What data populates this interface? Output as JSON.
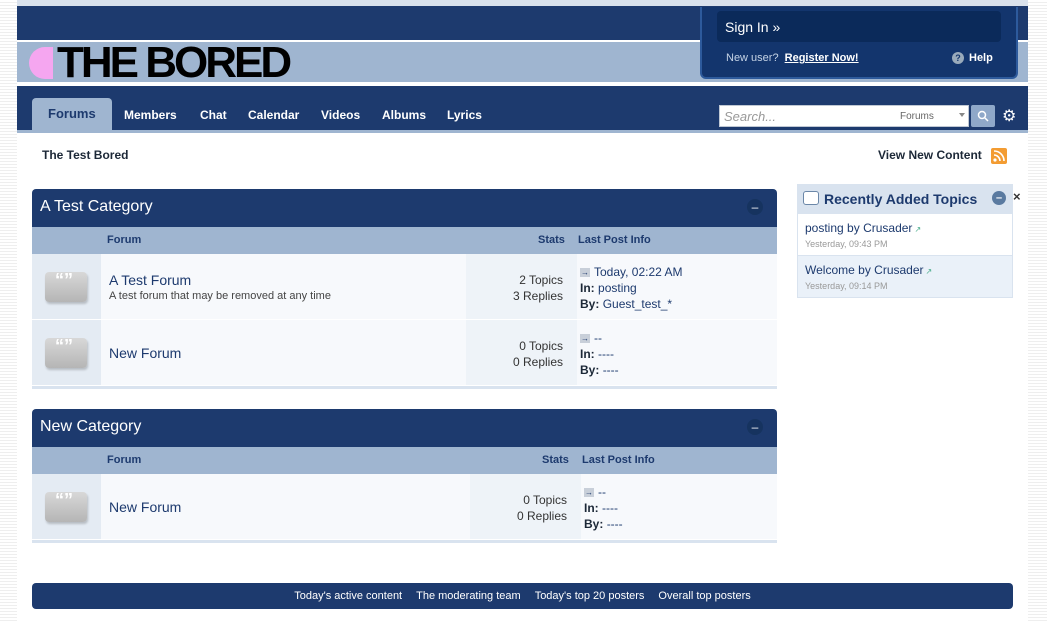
{
  "header": {
    "logo_text": "THE BORED",
    "signin_label": "Sign In »",
    "new_user_text": "New user?",
    "register_label": "Register Now!",
    "help_label": "Help"
  },
  "nav": {
    "tabs": [
      {
        "label": "Forums"
      },
      {
        "label": "Members"
      },
      {
        "label": "Chat"
      },
      {
        "label": "Calendar"
      },
      {
        "label": "Videos"
      },
      {
        "label": "Albums"
      },
      {
        "label": "Lyrics"
      }
    ],
    "search_placeholder": "Search...",
    "search_scope": "Forums"
  },
  "breadcrumb": "The Test Bored",
  "view_new_content": "View New Content",
  "categories": [
    {
      "title": "A Test Category",
      "toggle": "–",
      "col_forum": "Forum",
      "col_stats": "Stats",
      "col_lastpost": "Last Post Info",
      "forums": [
        {
          "name": "A Test Forum",
          "desc": "A test forum that may be removed at any time",
          "topics": "2 Topics",
          "replies": "3 Replies",
          "lp_date": "Today, 02:22 AM",
          "lp_in_label": "In:",
          "lp_in": "posting",
          "lp_by_label": "By:",
          "lp_by": "Guest_test_*"
        },
        {
          "name": "New Forum",
          "desc": "",
          "topics": "0 Topics",
          "replies": "0 Replies",
          "lp_date": "--",
          "lp_in_label": "In:",
          "lp_in": "----",
          "lp_by_label": "By:",
          "lp_by": "----"
        }
      ]
    },
    {
      "title": "New Category",
      "toggle": "–",
      "col_forum": "Forum",
      "col_stats": "Stats",
      "col_lastpost": "Last Post Info",
      "forums": [
        {
          "name": "New Forum",
          "desc": "",
          "topics": "0 Topics",
          "replies": "0 Replies",
          "lp_date": "--",
          "lp_in_label": "In:",
          "lp_in": "----",
          "lp_by_label": "By:",
          "lp_by": "----"
        }
      ]
    }
  ],
  "sidebar": {
    "title": "Recently Added Topics",
    "items": [
      {
        "topic": "posting",
        "by_word": "by",
        "author": "Crusader",
        "when": "Yesterday, 09:43 PM"
      },
      {
        "topic": "Welcome",
        "by_word": "by",
        "author": "Crusader",
        "when": "Yesterday, 09:14 PM"
      }
    ]
  },
  "footer": {
    "links": [
      "Today's active content",
      "The moderating team",
      "Today's top 20 posters",
      "Overall top posters"
    ]
  },
  "colors": {
    "primary": "#1d3a6e",
    "secondary": "#9fb5d0",
    "logo_accent": "#f5a6f0",
    "rss": "#f39c32"
  }
}
